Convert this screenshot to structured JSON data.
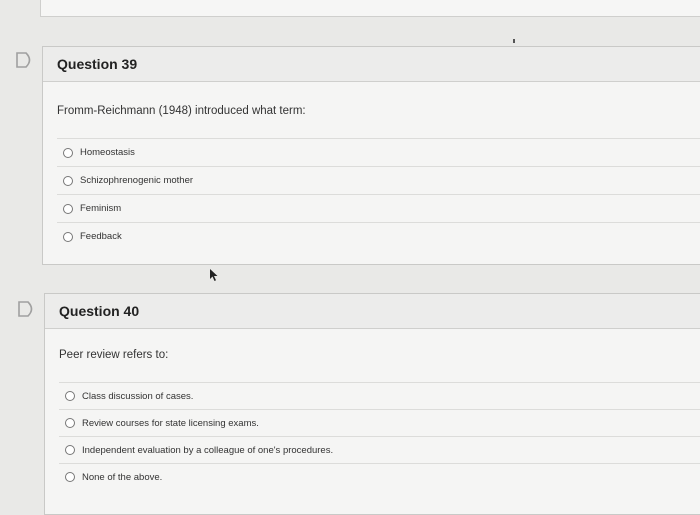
{
  "questions": [
    {
      "title": "Question 39",
      "prompt": "Fromm-Reichmann (1948) introduced what term:",
      "options": [
        "Homeostasis",
        "Schizophrenogenic mother",
        "Feminism",
        "Feedback"
      ]
    },
    {
      "title": "Question 40",
      "prompt": "Peer review refers to:",
      "options": [
        "Class discussion of cases.",
        "Review courses for state licensing exams.",
        "Independent evaluation by a colleague of one's procedures.",
        "None of the above."
      ]
    }
  ],
  "icons": {
    "flag": "flag-outline-icon",
    "radio": "radio-unselected-icon",
    "cursor": "mouse-pointer-icon"
  },
  "colors": {
    "page_bg": "#e9e9e7",
    "card_bg": "#f5f5f4",
    "header_bg": "#ececeb",
    "flag_color": "#a0a0a0"
  }
}
